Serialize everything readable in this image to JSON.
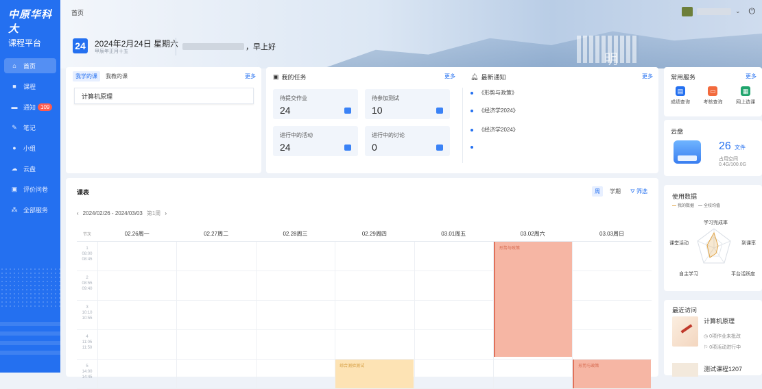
{
  "sidebar": {
    "logo": "中原华科大",
    "subtitle": "课程平台",
    "items": [
      {
        "icon": "home-icon",
        "label": "首页",
        "active": true
      },
      {
        "icon": "book-icon",
        "label": "课程"
      },
      {
        "icon": "notification-icon",
        "label": "通知",
        "badge": "109"
      },
      {
        "icon": "edit-icon",
        "label": "笔记"
      },
      {
        "icon": "group-icon",
        "label": "小组"
      },
      {
        "icon": "cloud-icon",
        "label": "云盘"
      },
      {
        "icon": "survey-icon",
        "label": "评价问卷"
      },
      {
        "icon": "grid-icon",
        "label": "全部服务"
      }
    ]
  },
  "header": {
    "breadcrumb": "首页",
    "date_day": "24",
    "date_text": "2024年2月24日  星期六",
    "lunar": "甲辰年正月十五",
    "greeting": "，早上好",
    "moon": "明"
  },
  "courses": {
    "tabs": [
      "我学的课",
      "我教的课"
    ],
    "more": "更多",
    "items": [
      "计算机原理"
    ]
  },
  "tasks": {
    "title": "我的任务",
    "more": "更多",
    "boxes": [
      {
        "label": "待提交作业",
        "value": "24"
      },
      {
        "label": "待参加测试",
        "value": "10"
      },
      {
        "label": "进行中的活动",
        "value": "24"
      },
      {
        "label": "进行中的讨论",
        "value": "0"
      }
    ]
  },
  "notices": {
    "title": "最新通知",
    "more": "更多",
    "items": [
      "《形势与政策》",
      "《经济学2024》",
      "《经济学2024》",
      ""
    ]
  },
  "timetable": {
    "title": "课表",
    "tools": [
      "周",
      "学期",
      "筛选"
    ],
    "range": "2024/02/26 - 2024/03/03",
    "week": "第1周",
    "section_label": "节次",
    "days": [
      "02.26周一",
      "02.27周二",
      "02.28周三",
      "02.29周四",
      "03.01周五",
      "03.02周六",
      "03.03周日"
    ],
    "slots": [
      {
        "num": "1",
        "start": "08:00",
        "end": "08:45"
      },
      {
        "num": "2",
        "start": "08:55",
        "end": "09:40"
      },
      {
        "num": "3",
        "start": "10:10",
        "end": "10:55"
      },
      {
        "num": "4",
        "start": "11:05",
        "end": "11:50"
      },
      {
        "num": "5",
        "start": "14:00",
        "end": "14:45"
      }
    ],
    "events": [
      "形势与政策",
      "形势与政策",
      "综合测验测试"
    ]
  },
  "services": {
    "title": "常用服务",
    "more": "更多",
    "items": [
      {
        "label": "成绩查询",
        "color": "#2470f0"
      },
      {
        "label": "考核查询",
        "color": "#f26a3d"
      },
      {
        "label": "网上选课",
        "color": "#20a56d"
      }
    ]
  },
  "cloud": {
    "title": "云盘",
    "count": "26",
    "unit": "文件",
    "used_label": "占用空间",
    "capacity": "0.4G/100.0G"
  },
  "usage": {
    "title": "使用数据",
    "legend": [
      "我的数据",
      "全校均值"
    ],
    "axes": [
      "学习完成率",
      "到课率",
      "平台活跃度",
      "自主学习",
      "课堂活动"
    ]
  },
  "recent": {
    "title": "最近访问",
    "items": [
      {
        "name": "计算机原理",
        "meta1": "0项作业未批改",
        "meta2": "0项活动进行中"
      },
      {
        "name": "测试课程1207"
      }
    ]
  }
}
